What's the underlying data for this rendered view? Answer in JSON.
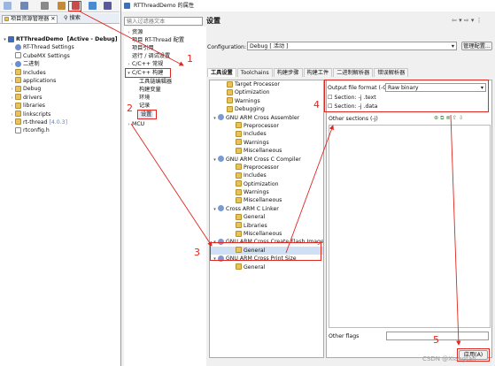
{
  "left": {
    "tab_project": "项目资源管理器",
    "tab_search": "搜索",
    "tree": [
      {
        "label": "RTThreadDemo",
        "tag": "[Active - Debug]"
      },
      {
        "label": "RT-Thread Settings"
      },
      {
        "label": "CubeMX Settings"
      },
      {
        "label": "二进制"
      },
      {
        "label": "Includes"
      },
      {
        "label": "applications"
      },
      {
        "label": "Debug"
      },
      {
        "label": "drivers"
      },
      {
        "label": "libraries"
      },
      {
        "label": "linkscripts"
      },
      {
        "label": "rt-thread",
        "tag": "[4.0.3]"
      },
      {
        "label": "rtconfig.h"
      }
    ]
  },
  "dialog": {
    "title": "RTThreadDemo 的属性",
    "filter_placeholder": "输入过滤器文本",
    "nav": [
      "资源",
      "项目 RT-Thread 配置",
      "项目引用",
      "运行 / 调试设置",
      "C/C++ 常规",
      "C/C++ 构建",
      "工具链编辑器",
      "构建变量",
      "环境",
      "记录",
      "设置",
      "MCU"
    ],
    "section_title": "设置",
    "config_label": "Configuration:",
    "config_value": "Debug [ 活动 ]",
    "manage_label": "管理配置...",
    "tabs": [
      "工具设置",
      "Toolchains",
      "构建步骤",
      "构建工件",
      "二进制解析器",
      "错误解析器"
    ],
    "tool_tree": [
      "Target Processor",
      "Optimization",
      "Warnings",
      "Debugging",
      "GNU ARM Cross Assembler",
      "Preprocessor",
      "Includes",
      "Warnings",
      "Miscellaneous",
      "GNU ARM Cross C Compiler",
      "Preprocessor",
      "Includes",
      "Optimization",
      "Warnings",
      "Miscellaneous",
      "Cross ARM C Linker",
      "General",
      "Libraries",
      "Miscellaneous",
      "GNU ARM Cross Create Flash Image",
      "General",
      "GNU ARM Cross Print Size",
      "General"
    ],
    "output_format_label": "Output file format (-O)",
    "output_format_value": "Raw binary",
    "section_text": "Section: -j .text",
    "section_data": "Section: -j .data",
    "other_sections": "Other sections (-j)",
    "other_flags": "Other flags",
    "apply_button": "应用(A)",
    "annotations": [
      "1",
      "2",
      "3",
      "4",
      "5"
    ]
  },
  "watermark": "CSDN @Xiangtan"
}
